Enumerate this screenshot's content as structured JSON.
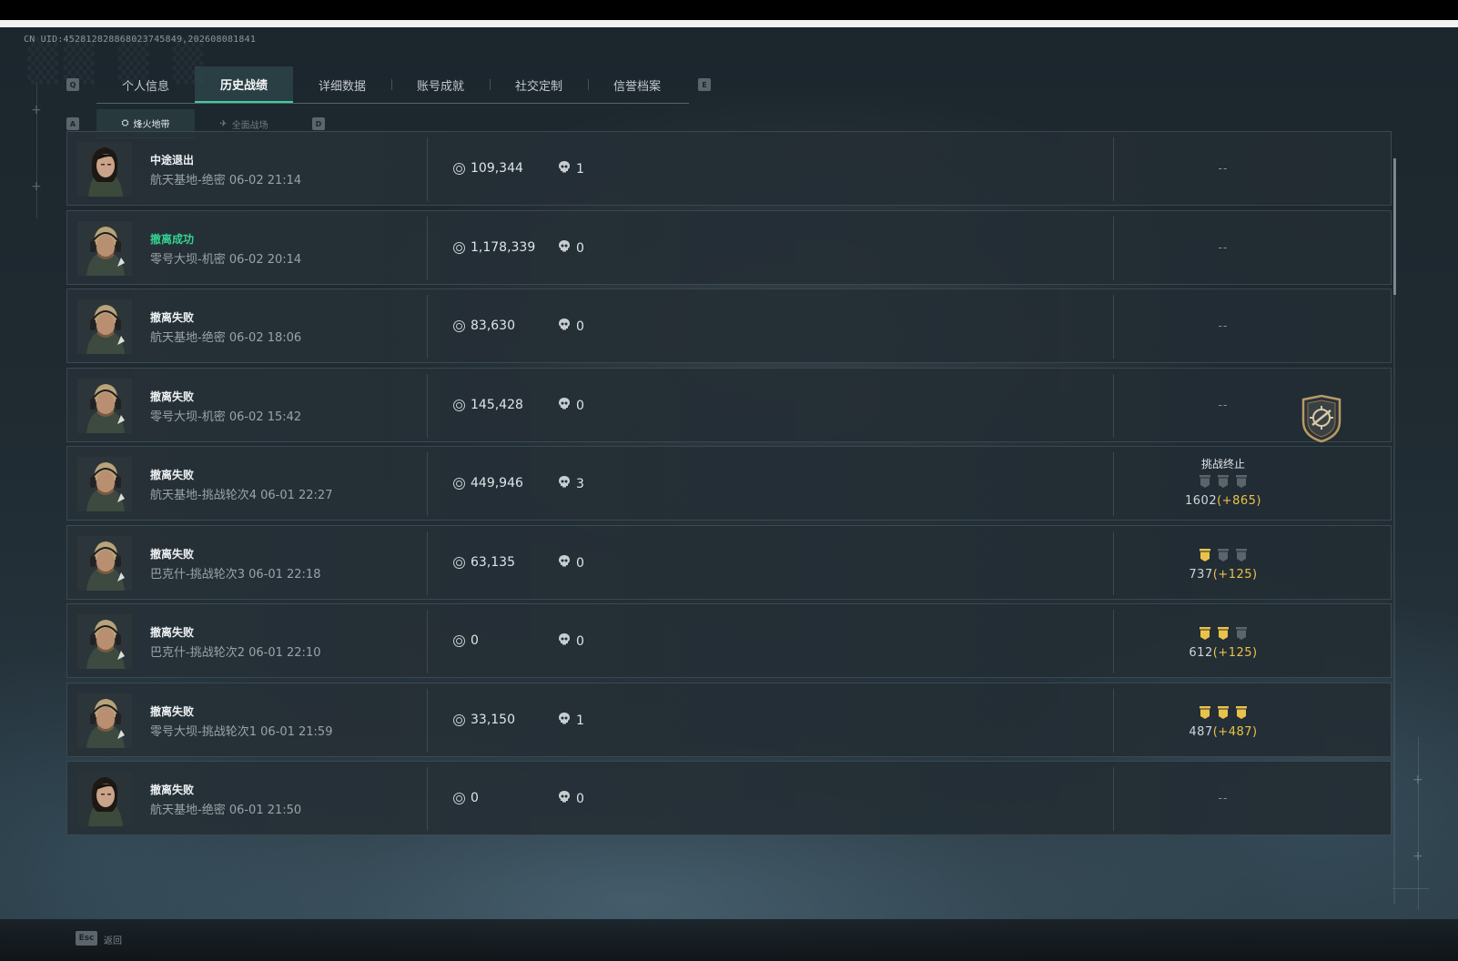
{
  "uid": "CN UID:452812828868023745849,202608081841",
  "keys": {
    "tab_prev": "Q",
    "tab_next": "E",
    "subtab_prev": "A",
    "subtab_next": "D",
    "back_key": "Esc"
  },
  "tabs": [
    "个人信息",
    "历史战绩",
    "详细数据",
    "账号成就",
    "社交定制",
    "信誉档案"
  ],
  "active_tab": "历史战绩",
  "subtabs": [
    {
      "icon": "flame-zone-icon",
      "label": "烽火地带",
      "active": true
    },
    {
      "icon": "battlefield-icon",
      "label": "全面战场",
      "active": false
    }
  ],
  "matches": [
    {
      "status": "中途退出",
      "status_type": "normal",
      "map": "航天基地-绝密 06-02 21:14",
      "value": "109,344",
      "kills": "1",
      "result": "--"
    },
    {
      "status": "撤离成功",
      "status_type": "success",
      "map": "零号大坝-机密 06-02 20:14",
      "value": "1,178,339",
      "kills": "0",
      "result": "--"
    },
    {
      "status": "撤离失败",
      "status_type": "normal",
      "map": "航天基地-绝密 06-02 18:06",
      "value": "83,630",
      "kills": "0",
      "result": "--"
    },
    {
      "status": "撤离失败",
      "status_type": "normal",
      "map": "零号大坝-机密 06-02 15:42",
      "value": "145,428",
      "kills": "0",
      "result": "--",
      "emblem": true
    },
    {
      "status": "撤离失败",
      "status_type": "normal",
      "map": "航天基地-挑战轮次4 06-01 22:27",
      "value": "449,946",
      "kills": "3",
      "challenge": {
        "title": "挑战终止",
        "filled": 0,
        "score": "1602",
        "delta": "(+865)"
      }
    },
    {
      "status": "撤离失败",
      "status_type": "normal",
      "map": "巴克什-挑战轮次3 06-01 22:18",
      "value": "63,135",
      "kills": "0",
      "challenge": {
        "title": "",
        "filled": 1,
        "score": "737",
        "delta": "(+125)"
      }
    },
    {
      "status": "撤离失败",
      "status_type": "normal",
      "map": "巴克什-挑战轮次2 06-01 22:10",
      "value": "0",
      "kills": "0",
      "challenge": {
        "title": "",
        "filled": 2,
        "score": "612",
        "delta": "(+125)"
      }
    },
    {
      "status": "撤离失败",
      "status_type": "normal",
      "map": "零号大坝-挑战轮次1 06-01 21:59",
      "value": "33,150",
      "kills": "1",
      "challenge": {
        "title": "",
        "filled": 3,
        "score": "487",
        "delta": "(+487)"
      }
    },
    {
      "status": "撤离失败",
      "status_type": "normal",
      "map": "航天基地-绝密 06-01 21:50",
      "value": "0",
      "kills": "0",
      "result": "--"
    }
  ],
  "avatars": [
    "female-operator",
    "male-operator",
    "male-operator",
    "male-operator",
    "male-operator",
    "male-operator",
    "male-operator",
    "male-operator",
    "female-operator"
  ],
  "footer": {
    "back_label": "返回"
  },
  "colors": {
    "accent": "#3fcf9a",
    "success": "#34d28f",
    "gold": "#e9c24a"
  }
}
